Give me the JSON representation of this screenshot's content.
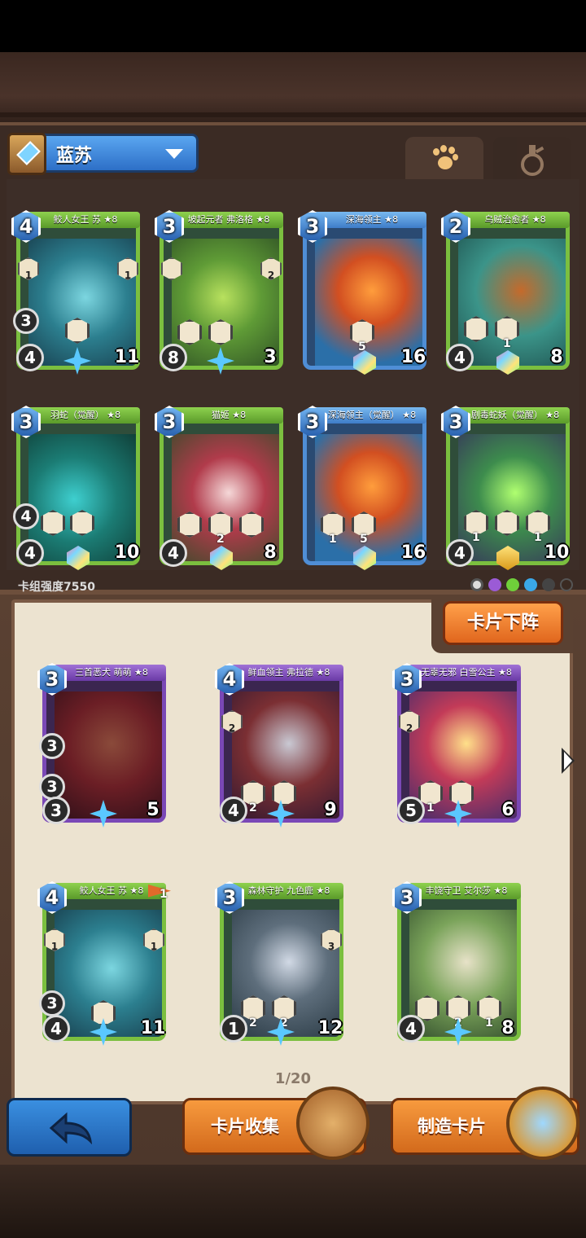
{
  "deck": {
    "name": "蓝苏"
  },
  "tabs": {
    "pets": "pets-tab",
    "potions": "potions-tab"
  },
  "deck_strength": "卡组强度7550",
  "unload_button": "卡片下阵",
  "page_indicator": "1/20",
  "bottom": {
    "collect_label": "卡片收集",
    "craft_label": "制造卡片"
  },
  "deck_cards": [
    {
      "title": "鲛人女王 苏 ★8",
      "cost": "4",
      "atk": "4",
      "hp": "11",
      "mid": "3",
      "badge_l": "1",
      "badge_r": "1",
      "s1": "",
      "s2": ""
    },
    {
      "title": "坡起元者 弗洛格 ★8",
      "cost": "3",
      "atk": "8",
      "hp": "3",
      "mid": "",
      "badge_l": "",
      "badge_r": "2",
      "s1": "",
      "s2": ""
    },
    {
      "title": "深海领主 ★8",
      "cost": "3",
      "atk": "",
      "hp": "16",
      "mid": "",
      "badge_l": "",
      "badge_r": "",
      "s1": "5",
      "s2": ""
    },
    {
      "title": "乌贼治愈者 ★8",
      "cost": "2",
      "atk": "4",
      "hp": "8",
      "mid": "",
      "badge_l": "",
      "badge_r": "",
      "s1": "",
      "s2": "1"
    },
    {
      "title": "羽蛇（觉醒） ★8",
      "cost": "3",
      "atk": "4",
      "hp": "10",
      "mid": "4",
      "badge_l": "",
      "badge_r": "",
      "s1": "",
      "s2": ""
    },
    {
      "title": "猫姬 ★8",
      "cost": "3",
      "atk": "4",
      "hp": "8",
      "mid": "",
      "badge_l": "",
      "badge_r": "",
      "s1": "2",
      "s2": ""
    },
    {
      "title": "深海领主（觉醒） ★8",
      "cost": "3",
      "atk": "",
      "hp": "16",
      "mid": "",
      "badge_l": "",
      "badge_r": "",
      "s1": "1",
      "s2": "5"
    },
    {
      "title": "剧毒蛇妖（觉醒） ★8",
      "cost": "3",
      "atk": "4",
      "hp": "10",
      "mid": "",
      "badge_l": "",
      "badge_r": "",
      "s1": "1",
      "s2": "1"
    }
  ],
  "collection_cards": [
    {
      "title": "三首恶犬 萌萌 ★8",
      "cost": "3",
      "atk": "3",
      "hp": "5",
      "mid": "3",
      "mid2": "3"
    },
    {
      "title": "鲜血领主 弗拉德 ★8",
      "cost": "4",
      "atk": "4",
      "hp": "9",
      "s1": "2",
      "badge_l": "2"
    },
    {
      "title": "无辜无邪 白雪公主 ★8",
      "cost": "3",
      "atk": "5",
      "hp": "6",
      "s1": "1",
      "badge_l": "2"
    },
    {
      "title": "鲛人女王 苏 ★8",
      "cost": "4",
      "atk": "4",
      "hp": "11",
      "mid": "3",
      "flag": "1",
      "badge_l": "1",
      "badge_r": "1"
    },
    {
      "title": "森林守护 九色鹿 ★8",
      "cost": "3",
      "atk": "1",
      "hp": "12",
      "s1": "2",
      "s2": "2",
      "badge_r": "3"
    },
    {
      "title": "丰饶守卫 艾尔莎 ★8",
      "cost": "3",
      "atk": "4",
      "hp": "8",
      "s1": "2",
      "s2": "1"
    }
  ],
  "colors": {
    "accent_orange": "#e0661d",
    "blue": "#2d6fc7",
    "green_frame": "#7bbf3f",
    "panel": "#3b2b24"
  }
}
